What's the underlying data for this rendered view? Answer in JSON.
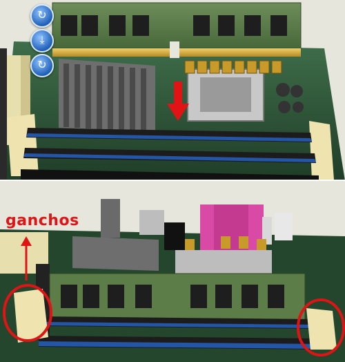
{
  "viewer_controls": {
    "rotate_icon": "↻",
    "download_icon": "⤓",
    "refresh_icon": "↻"
  },
  "annotation": {
    "label": "ganchos",
    "color": "#e01414"
  }
}
